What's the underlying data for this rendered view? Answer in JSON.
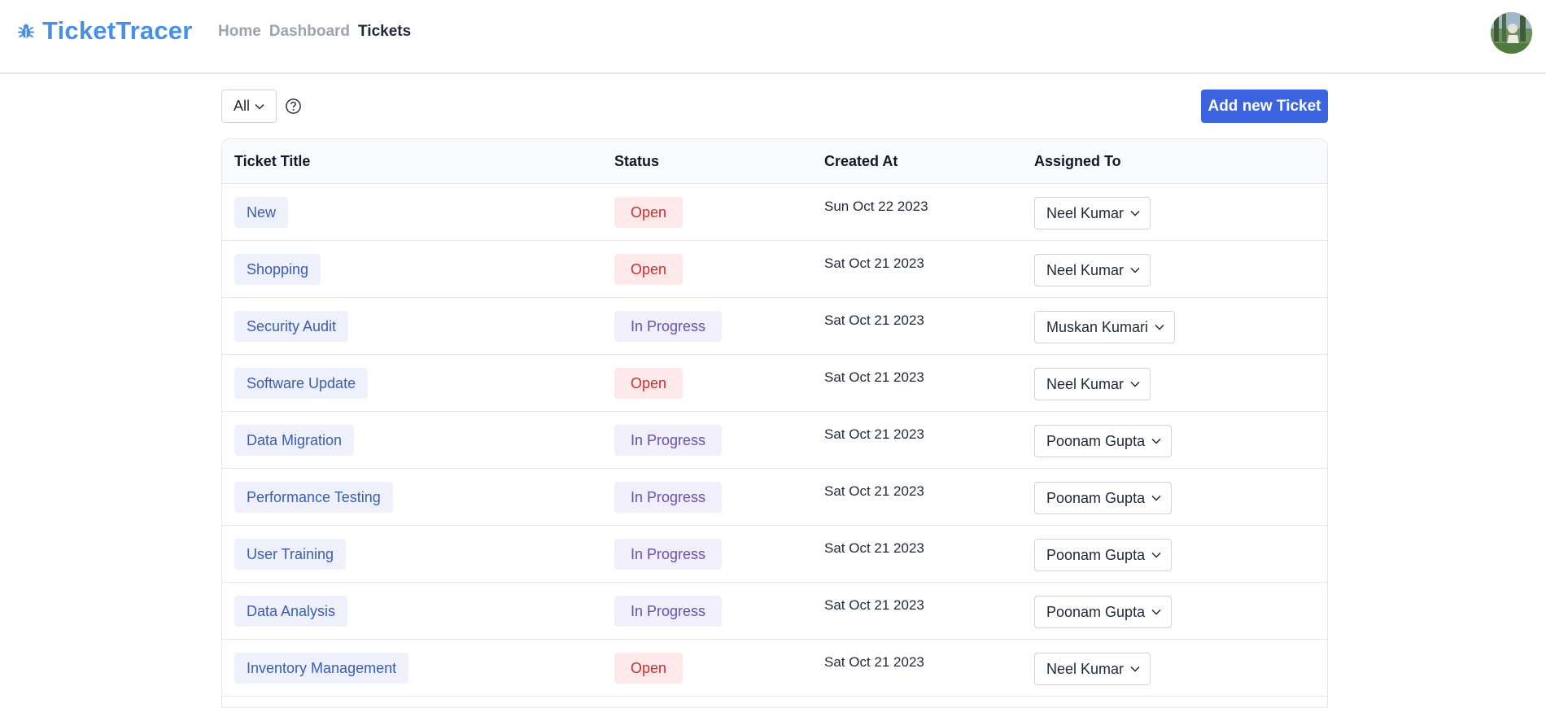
{
  "app": {
    "brand": "TicketTracer"
  },
  "nav": {
    "home": "Home",
    "dashboard": "Dashboard",
    "tickets": "Tickets"
  },
  "toolbar": {
    "filter_value": "All",
    "add_label": "Add new Ticket"
  },
  "table": {
    "headers": {
      "title": "Ticket Title",
      "status": "Status",
      "created": "Created At",
      "assigned": "Assigned To"
    },
    "rows": [
      {
        "title": "New",
        "status": "Open",
        "created": "Sun Oct 22 2023",
        "assigned": "Neel Kumar"
      },
      {
        "title": "Shopping",
        "status": "Open",
        "created": "Sat Oct 21 2023",
        "assigned": "Neel Kumar"
      },
      {
        "title": "Security Audit",
        "status": "In Progress",
        "created": "Sat Oct 21 2023",
        "assigned": "Muskan Kumari"
      },
      {
        "title": "Software Update",
        "status": "Open",
        "created": "Sat Oct 21 2023",
        "assigned": "Neel Kumar"
      },
      {
        "title": "Data Migration",
        "status": "In Progress",
        "created": "Sat Oct 21 2023",
        "assigned": "Poonam Gupta"
      },
      {
        "title": "Performance Testing",
        "status": "In Progress",
        "created": "Sat Oct 21 2023",
        "assigned": "Poonam Gupta"
      },
      {
        "title": "User Training",
        "status": "In Progress",
        "created": "Sat Oct 21 2023",
        "assigned": "Poonam Gupta"
      },
      {
        "title": "Data Analysis",
        "status": "In Progress",
        "created": "Sat Oct 21 2023",
        "assigned": "Poonam Gupta"
      },
      {
        "title": "Inventory Management",
        "status": "Open",
        "created": "Sat Oct 21 2023",
        "assigned": "Neel Kumar"
      }
    ]
  },
  "colors": {
    "brand": "#4a8fe7",
    "primary_button": "#3b63e0",
    "open_bg": "#fde8ea",
    "open_text": "#c9302c",
    "progress_bg": "#f1effc",
    "progress_text": "#6b4fb0"
  },
  "icons": {
    "brand": "bug-icon",
    "help": "question-circle-icon",
    "dropdown": "chevron-down-icon",
    "avatar": "user-avatar"
  }
}
